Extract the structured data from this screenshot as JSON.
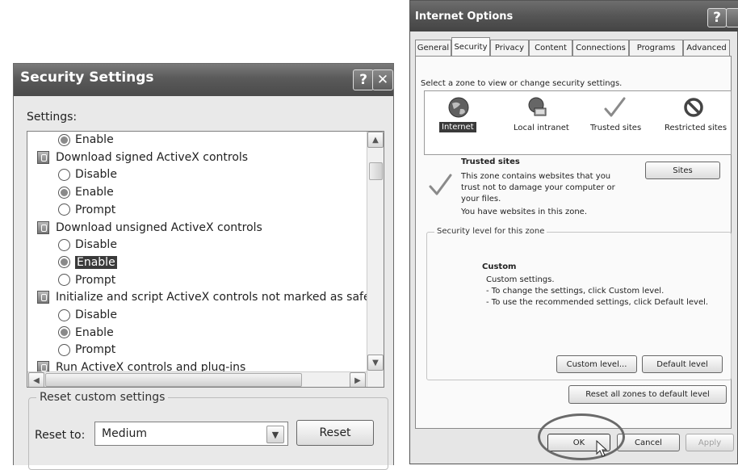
{
  "security_settings": {
    "title": "Security Settings",
    "help_button": "?",
    "close_button": "✕",
    "settings_label": "Settings:",
    "list_items": [
      {
        "kind": "radio",
        "label": "Enable",
        "checked": true,
        "selected": false
      },
      {
        "kind": "header",
        "label": "Download signed ActiveX controls"
      },
      {
        "kind": "radio",
        "label": "Disable",
        "checked": false,
        "selected": false
      },
      {
        "kind": "radio",
        "label": "Enable",
        "checked": true,
        "selected": false
      },
      {
        "kind": "radio",
        "label": "Prompt",
        "checked": false,
        "selected": false
      },
      {
        "kind": "header",
        "label": "Download unsigned ActiveX controls"
      },
      {
        "kind": "radio",
        "label": "Disable",
        "checked": false,
        "selected": false
      },
      {
        "kind": "radio",
        "label": "Enable",
        "checked": true,
        "selected": true
      },
      {
        "kind": "radio",
        "label": "Prompt",
        "checked": false,
        "selected": false
      },
      {
        "kind": "header",
        "label": "Initialize and script ActiveX controls not marked as safe"
      },
      {
        "kind": "radio",
        "label": "Disable",
        "checked": false,
        "selected": false
      },
      {
        "kind": "radio",
        "label": "Enable",
        "checked": true,
        "selected": false
      },
      {
        "kind": "radio",
        "label": "Prompt",
        "checked": false,
        "selected": false
      },
      {
        "kind": "header",
        "label": "Run ActiveX controls and plug-ins"
      }
    ],
    "reset_group_label": "Reset custom settings",
    "reset_to_label": "Reset to:",
    "reset_to_value": "Medium",
    "reset_button": "Reset"
  },
  "internet_options": {
    "title": "Internet Options",
    "help_button": "?",
    "tabs": [
      "General",
      "Security",
      "Privacy",
      "Content",
      "Connections",
      "Programs",
      "Advanced"
    ],
    "active_tab": "Security",
    "zone_prompt": "Select a zone to view or change security settings.",
    "zones": [
      {
        "label": "Internet",
        "icon": "globe-icon",
        "selected": true
      },
      {
        "label": "Local intranet",
        "icon": "intranet-icon",
        "selected": false
      },
      {
        "label": "Trusted sites",
        "icon": "checkmark-icon",
        "selected": false
      },
      {
        "label": "Restricted sites",
        "icon": "restricted-icon",
        "selected": false
      }
    ],
    "zone_heading": "Trusted sites",
    "zone_description": [
      "This zone contains websites that you",
      "trust not to damage your computer or",
      "your files.",
      "You have websites in this zone."
    ],
    "sites_button": "Sites",
    "security_level_label": "Security level for this zone",
    "level_title": "Custom",
    "level_lines": [
      "Custom settings.",
      "- To change the settings, click Custom level.",
      "- To use the recommended settings, click Default level."
    ],
    "custom_level_button": "Custom level...",
    "default_level_button": "Default level",
    "reset_all_button": "Reset all zones to default level",
    "ok_button": "OK",
    "cancel_button": "Cancel",
    "apply_button": "Apply"
  },
  "colors": {
    "selection": "#3a3a3a",
    "titlebar": "#5a5a5a",
    "annotation_circle": "#6a6a6a"
  }
}
